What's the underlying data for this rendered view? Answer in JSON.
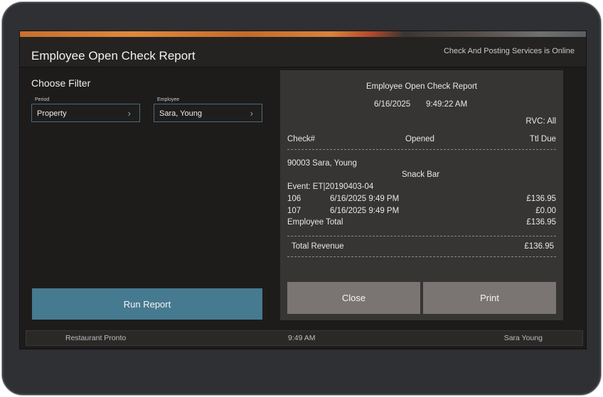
{
  "header": {
    "title": "Employee Open Check Report",
    "status": "Check And Posting Services is Online"
  },
  "filter": {
    "title": "Choose Filter",
    "period_label": "Period",
    "period_value": "Property",
    "employee_label": "Employee",
    "employee_value": "Sara, Young",
    "run_label": "Run Report"
  },
  "report": {
    "title": "Employee Open Check Report",
    "date": "6/16/2025",
    "time": "9:49:22 AM",
    "rvc": "RVC: All",
    "columns": {
      "check": "Check#",
      "opened": "Opened",
      "due": "Ttl Due"
    },
    "employee_line": "90003 Sara, Young",
    "location": "Snack Bar",
    "event": "Event: ET|20190403-04",
    "rows": [
      {
        "check": "106",
        "opened": "6/16/2025 9:49 PM",
        "due": "£136.95"
      },
      {
        "check": "107",
        "opened": "6/16/2025 9:49 PM",
        "due": "£0.00"
      }
    ],
    "employee_total_label": "Employee Total",
    "employee_total_value": "£136.95",
    "total_revenue_label": "Total Revenue",
    "total_revenue_value": "£136.95"
  },
  "actions": {
    "close_label": "Close",
    "print_label": "Print"
  },
  "footer": {
    "restaurant": "Restaurant Pronto",
    "time": "9:49 AM",
    "user": "Sara Young"
  }
}
